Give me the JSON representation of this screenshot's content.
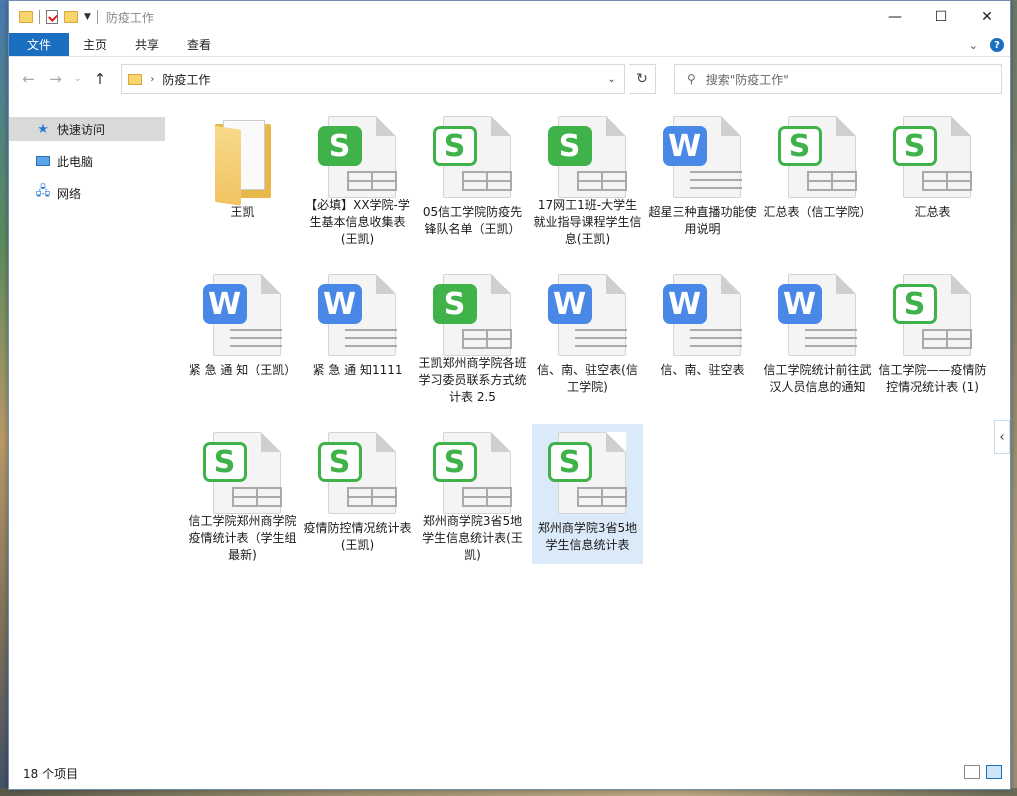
{
  "title_bar": {
    "title": "防疫工作",
    "minimize": "—",
    "maximize": "☐",
    "close": "✕"
  },
  "ribbon": {
    "tabs": [
      "文件",
      "主页",
      "共享",
      "查看"
    ]
  },
  "address": {
    "path": "防疫工作",
    "search_placeholder": "搜索\"防疫工作\""
  },
  "nav_pane": {
    "items": [
      "快速访问",
      "此电脑",
      "网络"
    ]
  },
  "files": [
    {
      "name": "王凯",
      "type": "folder",
      "icon": "folder-icon"
    },
    {
      "name": "【必填】XX学院-学生基本信息收集表(王凯)",
      "type": "s",
      "icon": "spreadsheet-icon"
    },
    {
      "name": "05信工学院防疫先锋队名单（王凯）",
      "type": "s-outline",
      "icon": "spreadsheet-icon"
    },
    {
      "name": "17网工1班-大学生就业指导课程学生信息(王凯)",
      "type": "s",
      "icon": "spreadsheet-icon"
    },
    {
      "name": "超星三种直播功能使用说明",
      "type": "w",
      "icon": "document-icon"
    },
    {
      "name": "汇总表（信工学院）",
      "type": "s-outline",
      "icon": "spreadsheet-icon"
    },
    {
      "name": "汇总表",
      "type": "s-outline",
      "icon": "spreadsheet-icon"
    },
    {
      "name": "紧 急 通 知（王凯）",
      "type": "w",
      "icon": "document-icon"
    },
    {
      "name": "紧 急 通 知1111",
      "type": "w",
      "icon": "document-icon"
    },
    {
      "name": "王凯郑州商学院各班学习委员联系方式统计表 2.5",
      "type": "s",
      "icon": "spreadsheet-icon"
    },
    {
      "name": "信、南、驻空表(信工学院)",
      "type": "w",
      "icon": "document-icon"
    },
    {
      "name": "信、南、驻空表",
      "type": "w",
      "icon": "document-icon"
    },
    {
      "name": "信工学院统计前往武汉人员信息的通知",
      "type": "w",
      "icon": "document-icon"
    },
    {
      "name": "信工学院——疫情防控情况统计表 (1)",
      "type": "s-outline",
      "icon": "spreadsheet-icon"
    },
    {
      "name": "信工学院郑州商学院疫情统计表（学生组最新)",
      "type": "s-outline",
      "icon": "spreadsheet-icon"
    },
    {
      "name": "疫情防控情况统计表(王凯)",
      "type": "s-outline",
      "icon": "spreadsheet-icon"
    },
    {
      "name": "郑州商学院3省5地学生信息统计表(王凯)",
      "type": "s-outline",
      "icon": "spreadsheet-icon"
    },
    {
      "name": "郑州商学院3省5地学生信息统计表",
      "type": "s-outline",
      "icon": "spreadsheet-icon",
      "selected": true
    }
  ],
  "status": {
    "count": "18 个项目"
  },
  "colors": {
    "accent": "#1a6fc0",
    "spreadsheet_green": "#3fb24a",
    "writer_blue": "#4a88e8",
    "selection": "#dbeaf8"
  }
}
